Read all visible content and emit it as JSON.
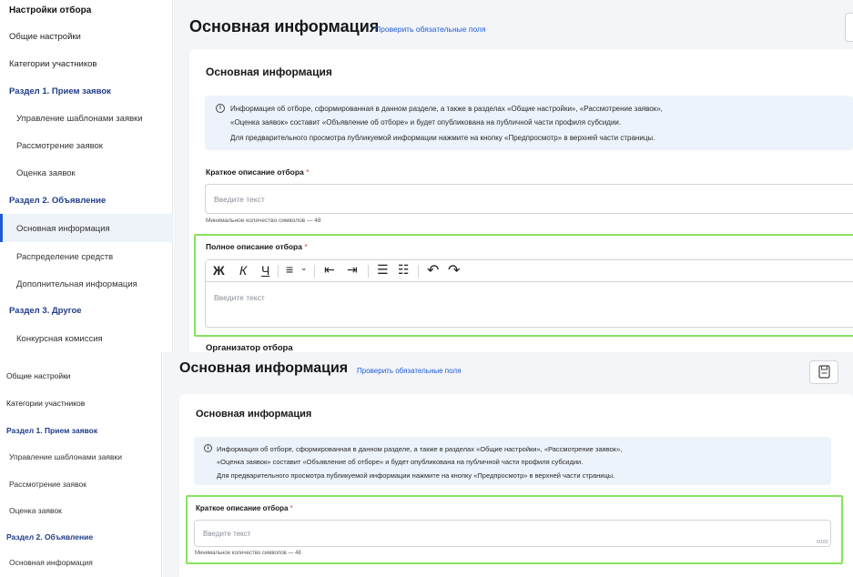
{
  "top": {
    "sidebar": {
      "header": "Настройки отбора",
      "items": [
        {
          "label": "Общие настройки",
          "kind": "item"
        },
        {
          "label": "Категории участников",
          "kind": "item"
        },
        {
          "label": "Раздел 1. Прием заявок",
          "kind": "section"
        },
        {
          "label": "Управление шаблонами заявки",
          "kind": "sub"
        },
        {
          "label": "Рассмотрение заявок",
          "kind": "sub"
        },
        {
          "label": "Оценка заявок",
          "kind": "sub"
        },
        {
          "label": "Раздел 2. Объявление",
          "kind": "section"
        },
        {
          "label": "Основная информация",
          "kind": "sub",
          "active": true
        },
        {
          "label": "Распределение средств",
          "kind": "sub"
        },
        {
          "label": "Дополнительная информация",
          "kind": "sub"
        },
        {
          "label": "Раздел 3. Другое",
          "kind": "section"
        },
        {
          "label": "Конкурсная комиссия",
          "kind": "sub"
        }
      ]
    },
    "main": {
      "title": "Основная информация",
      "check_link": "Проверить обязательные поля",
      "card_title": "Основная информация",
      "info_lines": [
        "Информация об отборе, сформированная в данном разделе, а также в разделах «Общие настройки», «Рассмотрение заявок»,",
        "«Оценка заявок» составит «Объявление об отборе» и будет опубликована на публичной части профиля субсидии.",
        "Для предварительного просмотра публикуемой информации нажмите на кнопку «Предпросмотр» в верхней части страницы."
      ],
      "short_label": "Краткое описание отбора",
      "short_placeholder": "Введите текст",
      "short_hint": "Минимальное количество символов — 48",
      "full_label": "Полное описание отбора",
      "full_placeholder": "Введите текст",
      "toolbar": {
        "bold": "Ж",
        "italic": "К",
        "underline": "Ч",
        "align": "≡",
        "align_caret": "⌄",
        "outdent": "⇤",
        "indent": "⇥",
        "bullets": "☰",
        "numbered": "☷",
        "undo": "↶",
        "redo": "↷"
      },
      "organizer_label": "Организатор отбора",
      "required_mark": "*"
    }
  },
  "bottom": {
    "sidebar": {
      "items": [
        {
          "label": "Общие настройки",
          "kind": "item"
        },
        {
          "label": "Категории участников",
          "kind": "item"
        },
        {
          "label": "Раздел 1. Прием заявок",
          "kind": "section"
        },
        {
          "label": "Управление шаблонами заявки",
          "kind": "sub"
        },
        {
          "label": "Рассмотрение заявок",
          "kind": "sub"
        },
        {
          "label": "Оценка заявок",
          "kind": "sub"
        },
        {
          "label": "Раздел 2. Объявление",
          "kind": "section"
        },
        {
          "label": "Основная информация",
          "kind": "sub"
        }
      ]
    },
    "main": {
      "title": "Основная информация",
      "check_link": "Проверить обязательные поля",
      "card_title": "Основная информация",
      "info_lines": [
        "Информация об отборе, сформированная в данном разделе, а также в разделах «Общие настройки», «Рассмотрение заявок»,",
        "«Оценка заявок» составит «Объявление об отборе» и будет опубликована на публичной части профиля субсидии.",
        "Для предварительного просмотра публикуемой информации нажмите на кнопку «Предпросмотр» в верхней части страницы."
      ],
      "short_label": "Краткое описание отбора",
      "short_placeholder": "Введите текст",
      "short_counter": "0/160",
      "short_hint": "Минимальное количество символов — 48",
      "required_mark": "*"
    }
  },
  "colors": {
    "accent": "#1f5bd7",
    "section": "#1f3c88",
    "required": "#e0413a",
    "info_bg": "#ecf3fb",
    "highlight": "#86e35f"
  }
}
